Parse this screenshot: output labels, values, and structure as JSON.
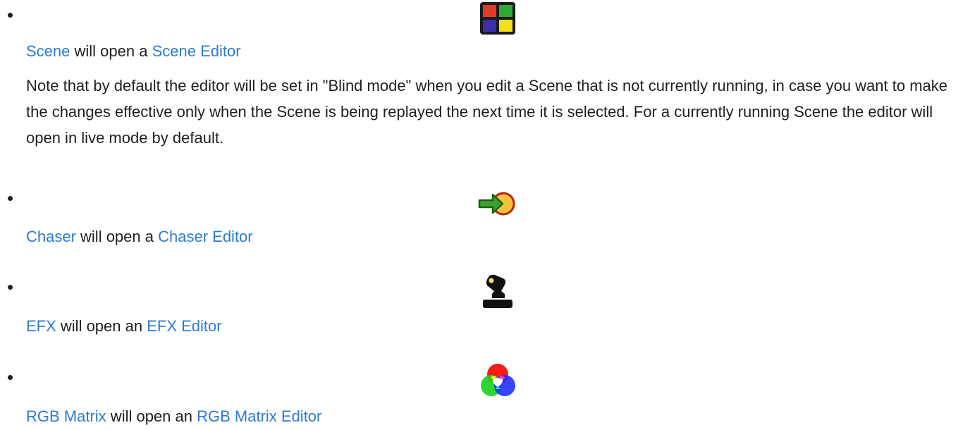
{
  "items": [
    {
      "icon": "scene-icon",
      "link1": "Scene",
      "middle": " will open a ",
      "link2": "Scene Editor",
      "note": "Note that by default the editor will be set in \"Blind mode\" when you edit a Scene that is not currently running, in case you want to make the changes effective only when the Scene is being replayed the next time it is selected. For a currently running Scene the editor will open in live mode by default."
    },
    {
      "icon": "chaser-icon",
      "link1": "Chaser",
      "middle": " will open a ",
      "link2": "Chaser Editor"
    },
    {
      "icon": "efx-icon",
      "link1": "EFX",
      "middle": " will open an ",
      "link2": "EFX Editor"
    },
    {
      "icon": "rgb-matrix-icon",
      "link1": "RGB Matrix",
      "middle": " will open an ",
      "link2": "RGB Matrix Editor"
    }
  ],
  "colors": {
    "link": "#2e7bd1",
    "text": "#1f1f1f"
  }
}
